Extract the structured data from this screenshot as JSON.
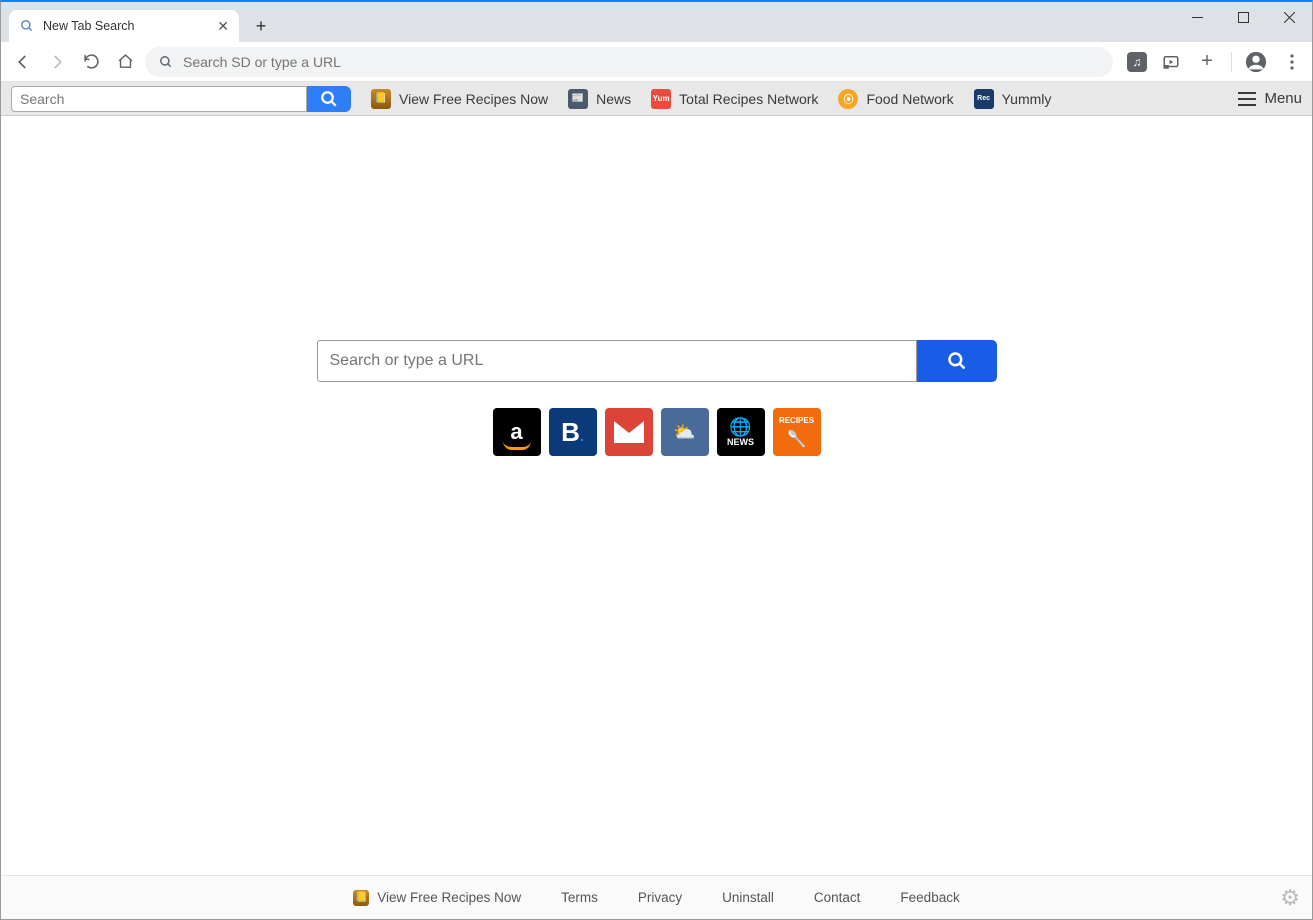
{
  "browser": {
    "tab_title": "New Tab Search",
    "omnibox_placeholder": "Search SD or type a URL"
  },
  "toolbar": {
    "search_placeholder": "Search",
    "links": [
      {
        "label": "View Free Recipes Now",
        "icon_bg": "#b8860b",
        "icon_txt": ""
      },
      {
        "label": "News",
        "icon_bg": "#4a5a6a",
        "icon_txt": ""
      },
      {
        "label": "Total Recipes Network",
        "icon_bg": "#e74c3c",
        "icon_txt": "Yum"
      },
      {
        "label": "Food Network",
        "icon_bg": "#f5a623",
        "icon_txt": ""
      },
      {
        "label": "Yummly",
        "icon_bg": "#1a3a6a",
        "icon_txt": ""
      }
    ],
    "menu_label": "Menu"
  },
  "page": {
    "search_placeholder": "Search or type a URL",
    "tiles": [
      {
        "name": "amazon"
      },
      {
        "name": "booking"
      },
      {
        "name": "gmail"
      },
      {
        "name": "weather"
      },
      {
        "name": "news"
      },
      {
        "name": "recipes"
      }
    ]
  },
  "footer": {
    "links": [
      "View Free Recipes Now",
      "Terms",
      "Privacy",
      "Uninstall",
      "Contact",
      "Feedback"
    ]
  }
}
